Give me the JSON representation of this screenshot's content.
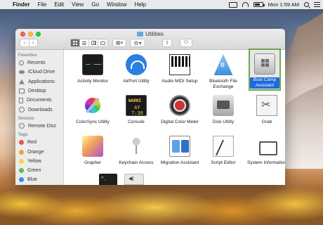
{
  "menubar": {
    "app_name": "Finder",
    "items": [
      "File",
      "Edit",
      "View",
      "Go",
      "Window",
      "Help"
    ],
    "clock": "Mon 1:59 AM"
  },
  "window": {
    "title": "Utilities"
  },
  "sidebar": {
    "favorites_header": "Favorites",
    "favorites": [
      "Recents",
      "iCloud Drive",
      "Applications",
      "Desktop",
      "Documents",
      "Downloads"
    ],
    "devices_header": "Devices",
    "devices": [
      "Remote Disc"
    ],
    "tags_header": "Tags",
    "tags": [
      {
        "label": "Red",
        "color": "#f0544a"
      },
      {
        "label": "Orange",
        "color": "#f5a22f"
      },
      {
        "label": "Yellow",
        "color": "#f6d344"
      },
      {
        "label": "Green",
        "color": "#5cc046"
      },
      {
        "label": "Blue",
        "color": "#3a8be8"
      }
    ]
  },
  "apps": [
    {
      "label": "Activity Monitor",
      "icon": "activity-monitor-icon"
    },
    {
      "label": "AirPort Utility",
      "icon": "airport-utility-icon"
    },
    {
      "label": "Audio MIDI Setup",
      "icon": "audio-midi-setup-icon"
    },
    {
      "label": "Bluetooth File Exchange",
      "icon": "bluetooth-file-exchange-icon"
    },
    {
      "label": "Boot Camp Assistant",
      "icon": "boot-camp-assistant-icon",
      "selected": true
    },
    {
      "label": "ColorSync Utility",
      "icon": "colorsync-utility-icon"
    },
    {
      "label": "Console",
      "icon": "console-icon",
      "icon_text": [
        "WARNI",
        "AY 7:36"
      ]
    },
    {
      "label": "Digital Color Meter",
      "icon": "digital-color-meter-icon"
    },
    {
      "label": "Disk Utility",
      "icon": "disk-utility-icon"
    },
    {
      "label": "Grab",
      "icon": "grab-icon"
    },
    {
      "label": "Grapher",
      "icon": "grapher-icon"
    },
    {
      "label": "Keychain Access",
      "icon": "keychain-access-icon"
    },
    {
      "label": "Migration Assistant",
      "icon": "migration-assistant-icon"
    },
    {
      "label": "Script Editor",
      "icon": "script-editor-icon"
    },
    {
      "label": "System Information",
      "icon": "system-information-icon"
    }
  ],
  "colors": {
    "selection_highlight": "#1d6ad8",
    "selected_outline": "#6aa84f"
  }
}
